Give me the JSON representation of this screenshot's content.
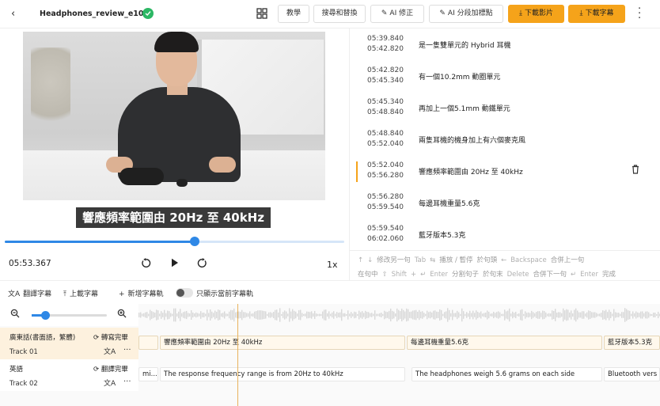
{
  "header": {
    "back_icon": "chevron-left-icon",
    "title": "Headphones_review_e104",
    "status_icon": "check-circle-icon",
    "grid_icon": "grid-icon",
    "buttons": {
      "tutorial": "教學",
      "search_replace": "搜尋和替換",
      "ai_fix": "AI 修正",
      "ai_split": "AI 分段加標點",
      "download_video": "下載影片",
      "download_subtitles": "下載字幕"
    },
    "more_icon": "kebab-icon",
    "accent_color": "#f5a31a"
  },
  "video": {
    "caption": "響應頻率範圍由 20Hz 至 40kHz",
    "progress_fraction": 0.56,
    "current_time": "05:53.367",
    "speed": "1x"
  },
  "subtitles": [
    {
      "start": "05:39.840",
      "end": "05:42.820",
      "text": "是一隻雙單元的 Hybrid 耳機"
    },
    {
      "start": "05:42.820",
      "end": "05:45.340",
      "text": "有一個10.2mm 動圈單元"
    },
    {
      "start": "05:45.340",
      "end": "05:48.840",
      "text": "再加上一個5.1mm 動鐵單元"
    },
    {
      "start": "05:48.840",
      "end": "05:52.040",
      "text": "兩隻耳機的機身加上有六個麥克風"
    },
    {
      "start": "05:52.040",
      "end": "05:56.280",
      "text": "響應頻率範圍由 20Hz 至 40kHz",
      "active": true
    },
    {
      "start": "05:56.280",
      "end": "05:59.540",
      "text": "每邊耳機重量5.6克"
    },
    {
      "start": "05:59.540",
      "end": "06:02.060",
      "text": "藍牙版本5.3克"
    }
  ],
  "shortcuts": {
    "row1": [
      "↑",
      "↓",
      "修改另一句",
      "Tab",
      "⇆",
      "播放 / 暫停",
      "於句頭",
      "←",
      "Backspace",
      "合併上一句"
    ],
    "row2": [
      "在句中",
      "⇧",
      "Shift",
      "+",
      "↵",
      "Enter",
      "分割句子",
      "於句末",
      "Delete",
      "合併下一句",
      "↵",
      "Enter",
      "完成"
    ]
  },
  "toolbar": {
    "translate": "翻譯字幕",
    "upload": "上載字幕",
    "add_track": "新增字幕軌",
    "only_current": "只顯示當前字幕軌"
  },
  "tracks": [
    {
      "lang": "廣東話(書面語，繁體)",
      "name": "Track 01",
      "status": "轉寫完畢"
    },
    {
      "lang": "英語",
      "name": "Track 02",
      "status": "翻譯完畢"
    }
  ],
  "lanes": {
    "track1": [
      "",
      "響應頻率範圍由 20Hz 至 40kHz",
      "每邊耳機重量5.6克",
      "藍牙版本5.3克"
    ],
    "track2": [
      "mi...",
      "The response frequency range is from 20Hz to 40kHz",
      "The headphones weigh 5.6 grams on each side",
      "Bluetooth vers"
    ]
  },
  "zoom": {
    "level_fraction": 0.18
  }
}
